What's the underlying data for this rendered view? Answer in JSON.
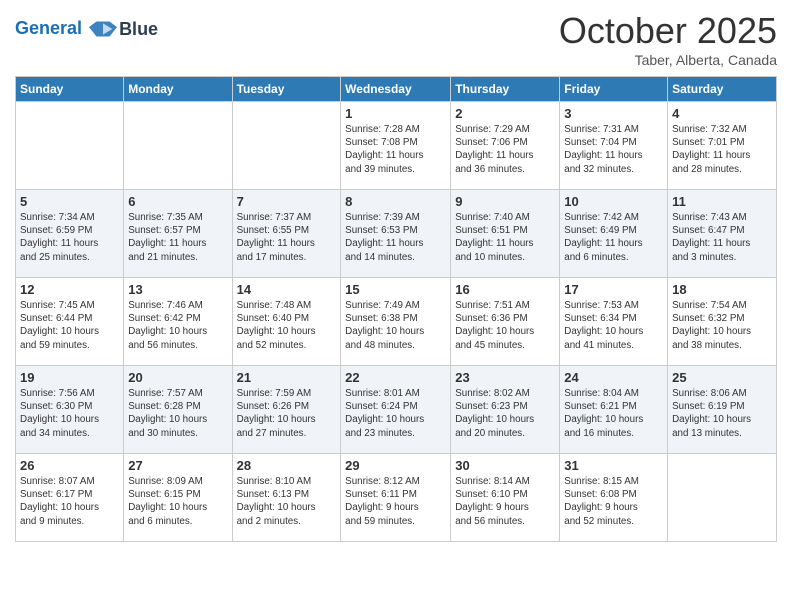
{
  "header": {
    "logo_line1": "General",
    "logo_line2": "Blue",
    "month": "October 2025",
    "location": "Taber, Alberta, Canada"
  },
  "weekdays": [
    "Sunday",
    "Monday",
    "Tuesday",
    "Wednesday",
    "Thursday",
    "Friday",
    "Saturday"
  ],
  "weeks": [
    [
      {
        "day": "",
        "info": ""
      },
      {
        "day": "",
        "info": ""
      },
      {
        "day": "",
        "info": ""
      },
      {
        "day": "1",
        "info": "Sunrise: 7:28 AM\nSunset: 7:08 PM\nDaylight: 11 hours\nand 39 minutes."
      },
      {
        "day": "2",
        "info": "Sunrise: 7:29 AM\nSunset: 7:06 PM\nDaylight: 11 hours\nand 36 minutes."
      },
      {
        "day": "3",
        "info": "Sunrise: 7:31 AM\nSunset: 7:04 PM\nDaylight: 11 hours\nand 32 minutes."
      },
      {
        "day": "4",
        "info": "Sunrise: 7:32 AM\nSunset: 7:01 PM\nDaylight: 11 hours\nand 28 minutes."
      }
    ],
    [
      {
        "day": "5",
        "info": "Sunrise: 7:34 AM\nSunset: 6:59 PM\nDaylight: 11 hours\nand 25 minutes."
      },
      {
        "day": "6",
        "info": "Sunrise: 7:35 AM\nSunset: 6:57 PM\nDaylight: 11 hours\nand 21 minutes."
      },
      {
        "day": "7",
        "info": "Sunrise: 7:37 AM\nSunset: 6:55 PM\nDaylight: 11 hours\nand 17 minutes."
      },
      {
        "day": "8",
        "info": "Sunrise: 7:39 AM\nSunset: 6:53 PM\nDaylight: 11 hours\nand 14 minutes."
      },
      {
        "day": "9",
        "info": "Sunrise: 7:40 AM\nSunset: 6:51 PM\nDaylight: 11 hours\nand 10 minutes."
      },
      {
        "day": "10",
        "info": "Sunrise: 7:42 AM\nSunset: 6:49 PM\nDaylight: 11 hours\nand 6 minutes."
      },
      {
        "day": "11",
        "info": "Sunrise: 7:43 AM\nSunset: 6:47 PM\nDaylight: 11 hours\nand 3 minutes."
      }
    ],
    [
      {
        "day": "12",
        "info": "Sunrise: 7:45 AM\nSunset: 6:44 PM\nDaylight: 10 hours\nand 59 minutes."
      },
      {
        "day": "13",
        "info": "Sunrise: 7:46 AM\nSunset: 6:42 PM\nDaylight: 10 hours\nand 56 minutes."
      },
      {
        "day": "14",
        "info": "Sunrise: 7:48 AM\nSunset: 6:40 PM\nDaylight: 10 hours\nand 52 minutes."
      },
      {
        "day": "15",
        "info": "Sunrise: 7:49 AM\nSunset: 6:38 PM\nDaylight: 10 hours\nand 48 minutes."
      },
      {
        "day": "16",
        "info": "Sunrise: 7:51 AM\nSunset: 6:36 PM\nDaylight: 10 hours\nand 45 minutes."
      },
      {
        "day": "17",
        "info": "Sunrise: 7:53 AM\nSunset: 6:34 PM\nDaylight: 10 hours\nand 41 minutes."
      },
      {
        "day": "18",
        "info": "Sunrise: 7:54 AM\nSunset: 6:32 PM\nDaylight: 10 hours\nand 38 minutes."
      }
    ],
    [
      {
        "day": "19",
        "info": "Sunrise: 7:56 AM\nSunset: 6:30 PM\nDaylight: 10 hours\nand 34 minutes."
      },
      {
        "day": "20",
        "info": "Sunrise: 7:57 AM\nSunset: 6:28 PM\nDaylight: 10 hours\nand 30 minutes."
      },
      {
        "day": "21",
        "info": "Sunrise: 7:59 AM\nSunset: 6:26 PM\nDaylight: 10 hours\nand 27 minutes."
      },
      {
        "day": "22",
        "info": "Sunrise: 8:01 AM\nSunset: 6:24 PM\nDaylight: 10 hours\nand 23 minutes."
      },
      {
        "day": "23",
        "info": "Sunrise: 8:02 AM\nSunset: 6:23 PM\nDaylight: 10 hours\nand 20 minutes."
      },
      {
        "day": "24",
        "info": "Sunrise: 8:04 AM\nSunset: 6:21 PM\nDaylight: 10 hours\nand 16 minutes."
      },
      {
        "day": "25",
        "info": "Sunrise: 8:06 AM\nSunset: 6:19 PM\nDaylight: 10 hours\nand 13 minutes."
      }
    ],
    [
      {
        "day": "26",
        "info": "Sunrise: 8:07 AM\nSunset: 6:17 PM\nDaylight: 10 hours\nand 9 minutes."
      },
      {
        "day": "27",
        "info": "Sunrise: 8:09 AM\nSunset: 6:15 PM\nDaylight: 10 hours\nand 6 minutes."
      },
      {
        "day": "28",
        "info": "Sunrise: 8:10 AM\nSunset: 6:13 PM\nDaylight: 10 hours\nand 2 minutes."
      },
      {
        "day": "29",
        "info": "Sunrise: 8:12 AM\nSunset: 6:11 PM\nDaylight: 9 hours\nand 59 minutes."
      },
      {
        "day": "30",
        "info": "Sunrise: 8:14 AM\nSunset: 6:10 PM\nDaylight: 9 hours\nand 56 minutes."
      },
      {
        "day": "31",
        "info": "Sunrise: 8:15 AM\nSunset: 6:08 PM\nDaylight: 9 hours\nand 52 minutes."
      },
      {
        "day": "",
        "info": ""
      }
    ]
  ]
}
